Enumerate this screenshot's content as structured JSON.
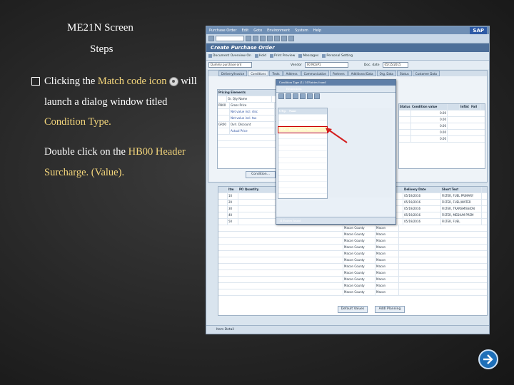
{
  "slide": {
    "title": "ME21N Screen",
    "subtitle": "Steps",
    "bullet": {
      "part1": "Clicking the ",
      "highlight1": "Match code icon",
      "part2": " will launch a dialog window titled ",
      "highlight2": "Condition Type."
    },
    "instruction": {
      "part1": "Double click on the ",
      "highlight1": "HB00",
      "part2": " ",
      "highlight2": "Header Surcharge. (Value)."
    },
    "colors": {
      "highlight": "#f3d57b",
      "nav": "#1e6fb8"
    }
  },
  "sap": {
    "menu": [
      "Purchase Order",
      "Edit",
      "Goto",
      "Environment",
      "System",
      "Help"
    ],
    "logo": "SAP",
    "window_title": "Create Purchase Order",
    "toolbar": [
      "Document Overview On",
      "Hold",
      "Print Preview",
      "Messages",
      "Personal Setting"
    ],
    "doc_type": "Dummy purchase ord",
    "vendor_label": "Vendor",
    "vendor_value": "00 NCEP1",
    "doc_date_label": "Doc. date",
    "doc_date_value": "05/15/2015",
    "tabs": [
      "Delivery/Invoice",
      "Conditions",
      "Texts",
      "Address",
      "Communication",
      "Partners",
      "Additional Data",
      "Org. Data",
      "Status",
      "Customer Data"
    ],
    "cond_table": {
      "header": [
        "Pricing Elements",
        "Ct. Type",
        "Name"
      ],
      "rows": [
        [
          "",
          "",
          "Pricing Elements"
        ],
        [
          "",
          "",
          "Gr. Qty Name"
        ],
        [
          "",
          "PB00",
          "Gross Price"
        ],
        [
          "",
          "",
          "Net value incl. disc"
        ],
        [
          "",
          "",
          "Net value incl. tax"
        ],
        [
          "",
          "GR00",
          "Ovrl. Discount"
        ],
        [
          "",
          "",
          "Actual Price"
        ]
      ],
      "right_header": [
        "Status",
        "Condition value",
        "",
        "Inflat",
        "Fail"
      ],
      "right_values": [
        "0.00",
        "0.00",
        "0.00",
        "0.00",
        "0.00"
      ],
      "button": "Condition..."
    },
    "items": {
      "header": [
        "Itm",
        "PO Quantity",
        "",
        "",
        "Delivery Date",
        "Short Text"
      ],
      "rows": [
        [
          "10",
          "",
          "",
          "",
          "05/19/2016",
          "FILTER, FUEL PRIMARY"
        ],
        [
          "20",
          "",
          "",
          "",
          "05/19/2016",
          "FILTER, FUEL/WATER"
        ],
        [
          "30",
          "",
          "",
          "",
          "05/19/2016",
          "FILTER, TRANSMISSION"
        ],
        [
          "40",
          "",
          "",
          "",
          "05/19/2016",
          "FILTER, MEDIUM PREM"
        ],
        [
          "50",
          "",
          "",
          "",
          "05/19/2016",
          "FILTER, FUEL"
        ]
      ],
      "plant_rows": [
        [
          "Macon County",
          "Macon"
        ],
        [
          "Macon County",
          "Macon"
        ],
        [
          "Macon County",
          "Macon"
        ],
        [
          "Macon County",
          "Macon"
        ],
        [
          "Macon County",
          "Macon"
        ],
        [
          "Macon County",
          "Macon"
        ],
        [
          "Macon County",
          "Macon"
        ],
        [
          "Macon County",
          "Macon"
        ],
        [
          "Macon County",
          "Macon"
        ],
        [
          "Macon County",
          "Macon"
        ],
        [
          "Macon County",
          "Macon"
        ]
      ],
      "buttons": [
        "Default Values",
        "Addl Planning"
      ]
    },
    "status": "Item Detail"
  },
  "dialog": {
    "title": "Condition Type (1) 14 Entries found",
    "tab": "Restrictions",
    "header": [
      "CTyp",
      "Name"
    ],
    "rows": [
      [
        "FRA1",
        "Freight %"
      ],
      [
        "FRB1",
        "Freight (Value)"
      ],
      [
        "HB00",
        "Header Surch.(Value)"
      ],
      [
        "HD00",
        "Header Disc(Value)"
      ],
      [
        "RA00",
        "Discount % on Net"
      ],
      [
        "RA01",
        "Discount % on Gross"
      ],
      [
        "RB00",
        "Absolute discount"
      ],
      [
        "RC00",
        "Account Discount %"
      ],
      [
        "RL01",
        "Vendor Discount %"
      ],
      [
        "ZA00",
        "Surcharge % on Net"
      ],
      [
        "ZA01",
        "Surcharge % on Gross"
      ],
      [
        "ZB00",
        "Surcharge (Value)"
      ],
      [
        "ZC00",
        "Sales Local Share"
      ],
      [
        "ZD00",
        "Added Addl Surcharge"
      ]
    ],
    "selected_index": 2,
    "status": "14 Entries found"
  }
}
